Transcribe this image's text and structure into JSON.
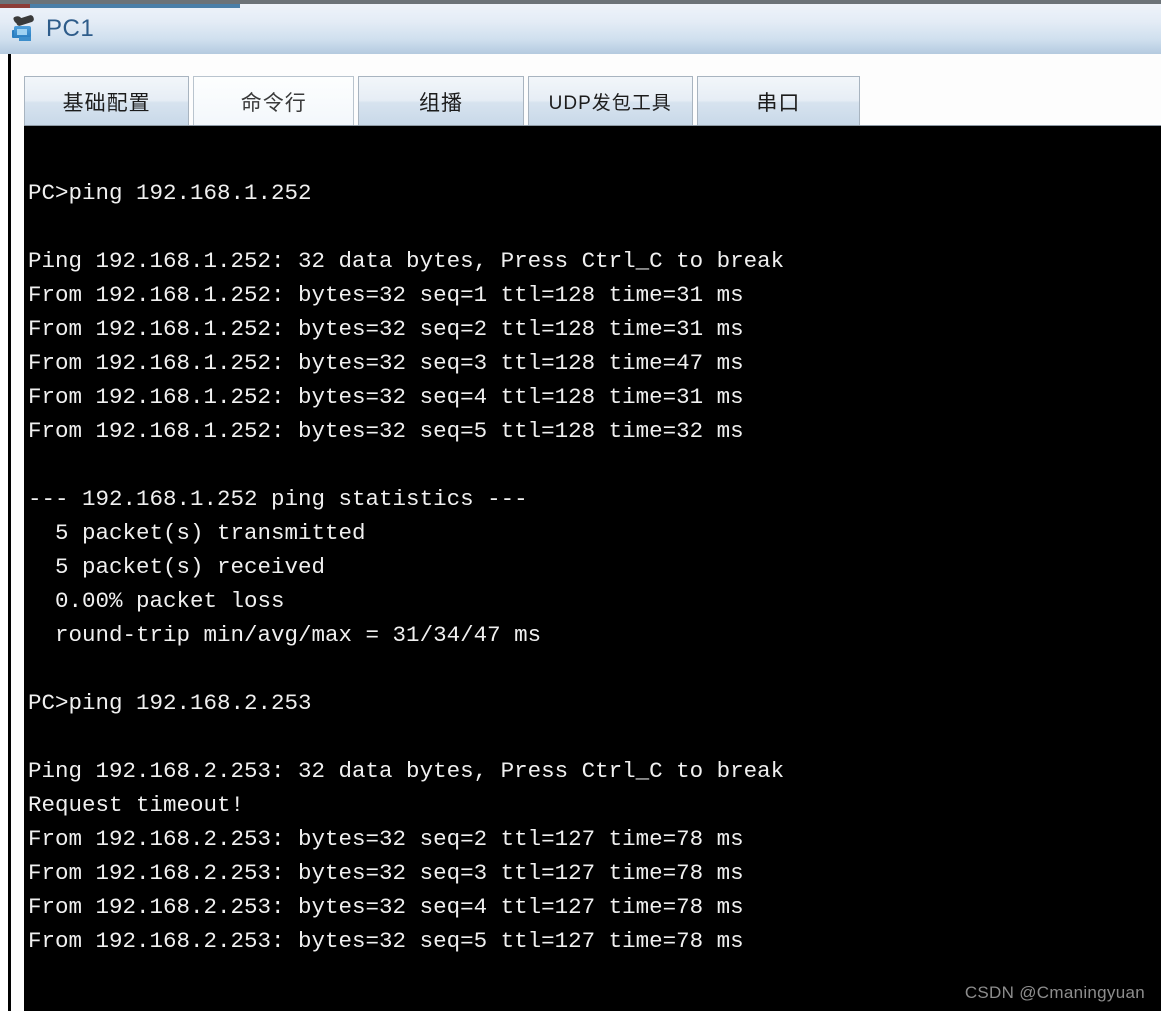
{
  "window": {
    "title": "PC1",
    "icon": "pc-device-icon"
  },
  "tabs": [
    {
      "label": "基础配置",
      "selected": false
    },
    {
      "label": "命令行",
      "selected": true
    },
    {
      "label": "组播",
      "selected": false
    },
    {
      "label": "UDP发包工具",
      "selected": false
    },
    {
      "label": "串口",
      "selected": false
    }
  ],
  "terminal": {
    "background": "#000000",
    "foreground": "#f0f0f0",
    "lines": [
      "",
      "PC>ping 192.168.1.252",
      "",
      "Ping 192.168.1.252: 32 data bytes, Press Ctrl_C to break",
      "From 192.168.1.252: bytes=32 seq=1 ttl=128 time=31 ms",
      "From 192.168.1.252: bytes=32 seq=2 ttl=128 time=31 ms",
      "From 192.168.1.252: bytes=32 seq=3 ttl=128 time=47 ms",
      "From 192.168.1.252: bytes=32 seq=4 ttl=128 time=31 ms",
      "From 192.168.1.252: bytes=32 seq=5 ttl=128 time=32 ms",
      "",
      "--- 192.168.1.252 ping statistics ---",
      "  5 packet(s) transmitted",
      "  5 packet(s) received",
      "  0.00% packet loss",
      "  round-trip min/avg/max = 31/34/47 ms",
      "",
      "PC>ping 192.168.2.253",
      "",
      "Ping 192.168.2.253: 32 data bytes, Press Ctrl_C to break",
      "Request timeout!",
      "From 192.168.2.253: bytes=32 seq=2 ttl=127 time=78 ms",
      "From 192.168.2.253: bytes=32 seq=3 ttl=127 time=78 ms",
      "From 192.168.2.253: bytes=32 seq=4 ttl=127 time=78 ms",
      "From 192.168.2.253: bytes=32 seq=5 ttl=127 time=78 ms"
    ]
  },
  "watermark": {
    "text": "CSDN @Cmaningyuan"
  }
}
